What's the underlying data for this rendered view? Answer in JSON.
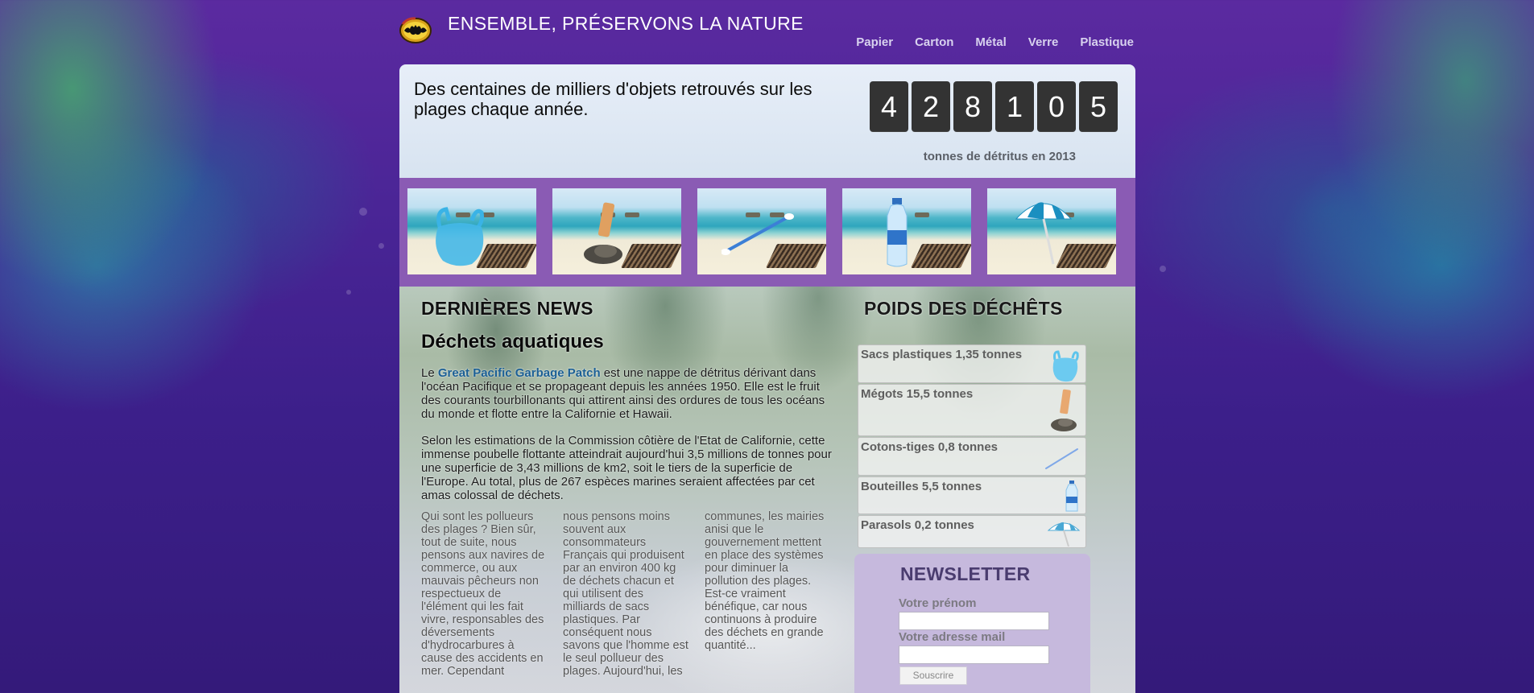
{
  "header": {
    "title": "ENSEMBLE, PRÉSERVONS LA NATURE",
    "nav": [
      "Papier",
      "Carton",
      "Métal",
      "Verre",
      "Plastique"
    ]
  },
  "hero": {
    "text": "Des centaines de milliers d'objets retrouvés sur les plages chaque année.",
    "counter_digits": [
      "4",
      "2",
      "8",
      "1",
      "0",
      "5"
    ],
    "counter_caption": "tonnes de détritus en 2013"
  },
  "gallery": [
    "plastic-bag",
    "cigarette-butt",
    "cotton-swab",
    "water-bottle",
    "parasol"
  ],
  "news": {
    "heading": "DERNIÈRES NEWS",
    "article_title": "Déchets aquatiques",
    "p1_before": "Le ",
    "p1_link": "Great Pacific Garbage Patch",
    "p1_after": " est une nappe de détritus dérivant dans l'océan Pacifique et se propageant depuis les années 1950. Elle est le fruit des courants tourbillonants qui attirent ainsi des ordures de tous les océans du monde et flotte entre la Californie et Hawaii.",
    "p2": "Selon les estimations de la Commission côtière de l'Etat de Californie, cette immense poubelle flottante atteindrait aujourd'hui 3,5 millions de tonnes pour une superficie de 3,43 millions de km2, soit le tiers de la superficie de l'Europe. Au total, plus de 267 espèces marines seraient affectées par cet amas colossal de déchets.",
    "col1": "Qui sont les pollueurs des plages ? Bien sûr, tout de suite, nous pensons aux navires de commerce, ou aux mauvais pêcheurs non respectueux de l'élément qui les fait vivre, responsables des déversements d'hydrocarbures à cause des accidents en mer. Cependant",
    "col2": "nous pensons moins souvent aux consommateurs Français qui produisent par an environ 400 kg de déchets chacun et qui utilisent des milliards de sacs plastiques. Par conséquent nous savons que l'homme est le seul pollueur des plages. Aujourd'hui, les",
    "col3": "communes, les mairies anisi que le gouvernement mettent en place des systèmes pour diminuer la pollution des plages. Est-ce vraiment bénéfique, car nous continuons à produire des déchets en grande quantité..."
  },
  "weights": {
    "title": "POIDS DES DÉCHÊTS",
    "items": [
      {
        "label": "Sacs plastiques 1,35 tonnes",
        "icon": "plastic-bag-icon"
      },
      {
        "label": "Mégots 15,5 tonnes",
        "icon": "cigarette-butt-icon"
      },
      {
        "label": "Cotons-tiges 0,8 tonnes",
        "icon": "cotton-swab-icon"
      },
      {
        "label": "Bouteilles 5,5 tonnes",
        "icon": "bottle-icon"
      },
      {
        "label": "Parasols 0,2 tonnes",
        "icon": "parasol-icon"
      }
    ]
  },
  "newsletter": {
    "title": "NEWSLETTER",
    "firstname_label": "Votre prénom",
    "firstname_value": "",
    "email_label": "Votre adresse mail",
    "email_value": "",
    "submit_label": "Souscrire"
  },
  "colors": {
    "accent_strip": "#8a5bb4",
    "counter_bg": "#333333",
    "link": "#1b5f95",
    "newsletter_bg": "#c6b9dd"
  }
}
